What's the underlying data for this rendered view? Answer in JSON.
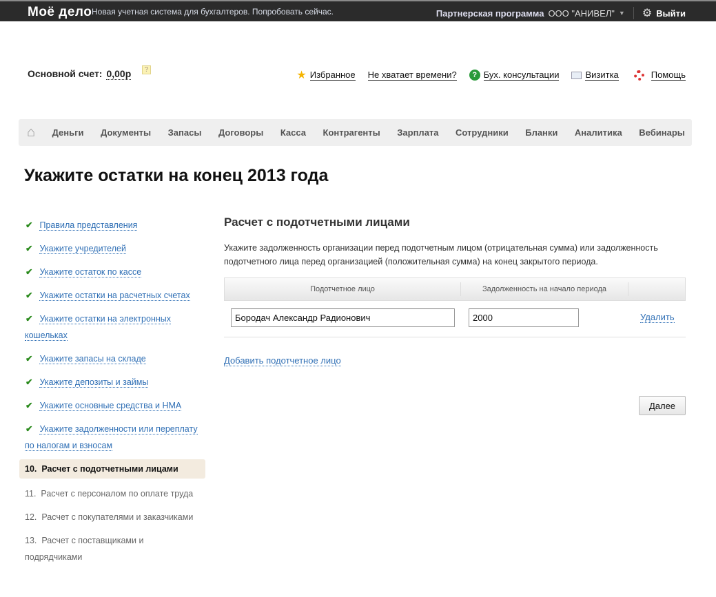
{
  "topbar": {
    "logo": "Моё дело",
    "promo": "Новая учетная система для бухгалтеров. Попробовать сейчас.",
    "partner": "Партнерская программа",
    "org": "ООО \"АНИВЕЛ\"",
    "logout": "Выйти"
  },
  "account": {
    "label": "Основной счет:",
    "value": "0,00р",
    "help": "?"
  },
  "links": [
    {
      "label": "Избранное"
    },
    {
      "label": "Не хватает времени?"
    },
    {
      "label": "Бух. консультации"
    },
    {
      "label": "Визитка"
    },
    {
      "label": "Помощь"
    }
  ],
  "nav": [
    "Деньги",
    "Документы",
    "Запасы",
    "Договоры",
    "Касса",
    "Контрагенты",
    "Зарплата",
    "Сотрудники",
    "Бланки",
    "Аналитика",
    "Вебинары"
  ],
  "page_title": "Укажите остатки на конец 2013 года",
  "steps": {
    "done": [
      "Правила представления",
      "Укажите учредителей",
      "Укажите остаток по кассе",
      "Укажите остатки на расчетных счетах",
      "Укажите остатки на электронных кошельках",
      "Укажите запасы на складе",
      "Укажите депозиты и займы",
      "Укажите основные средства и НМА",
      "Укажите задолженности или переплату по налогам и взносам"
    ],
    "current": {
      "num": "10.",
      "label": "Расчет с подотчетными лицами"
    },
    "todo": [
      {
        "num": "11.",
        "label": "Расчет с персоналом по оплате труда"
      },
      {
        "num": "12.",
        "label": "Расчет с покупателями и заказчиками"
      },
      {
        "num": "13.",
        "label": "Расчет с поставщиками и подрядчиками"
      }
    ]
  },
  "main": {
    "heading": "Расчет с подотчетными лицами",
    "description": "Укажите задолженность организации перед подотчетным лицом (отрицательная сумма) или задолженность подотчетного лица перед организацией (положительная сумма) на конец закрытого периода.",
    "columns": [
      "Подотчетное лицо",
      "Задолженность на начало периода"
    ],
    "rows": [
      {
        "person": "Бородач Александр Радионович",
        "amount": "2000",
        "delete": "Удалить"
      }
    ],
    "add_link": "Добавить подотчетное лицо",
    "next_button": "Далее"
  }
}
